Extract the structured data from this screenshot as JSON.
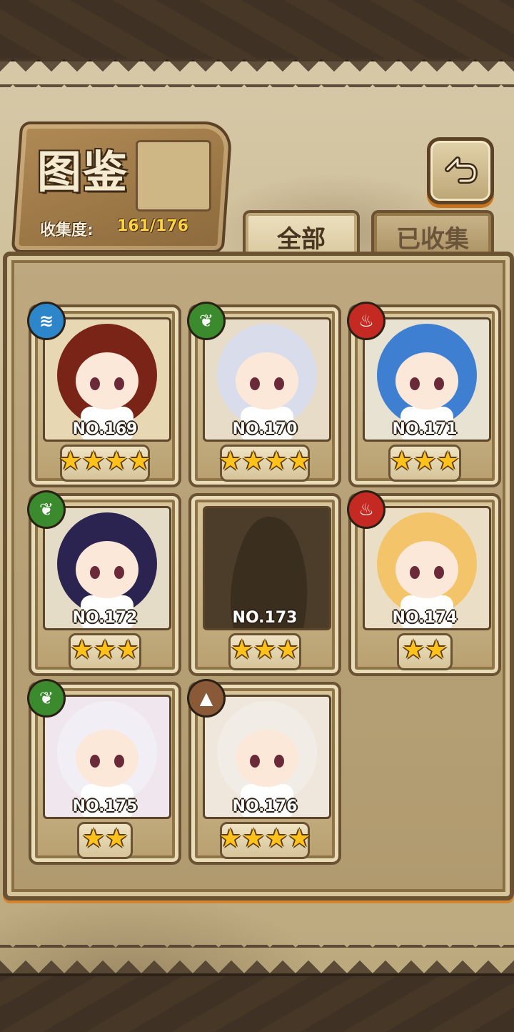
{
  "header": {
    "title": "图鉴",
    "collection_label": "收集度:",
    "collection_value": "161/176"
  },
  "tabs": [
    {
      "label": "全部",
      "active": true
    },
    {
      "label": "已收集",
      "active": false
    }
  ],
  "colors": {
    "accent_orange": "#d28530",
    "collection_value": "#ffd23e",
    "star": "#ffc21a",
    "water": "#2c86c9",
    "leaf": "#3b8a2e",
    "fire": "#c42a22",
    "earth": "#8a5a38"
  },
  "cards": [
    {
      "number": "NO.169",
      "stars": 4,
      "element": "water",
      "element_icon": "water-wave-icon",
      "collected": true,
      "art_bg": "#e7d7b3",
      "hair": "#7a2418"
    },
    {
      "number": "NO.170",
      "stars": 4,
      "element": "leaf",
      "element_icon": "leaf-icon",
      "collected": true,
      "art_bg": "#e6dcc7",
      "hair": "#d9dcea"
    },
    {
      "number": "NO.171",
      "stars": 3,
      "element": "fire",
      "element_icon": "flame-icon",
      "collected": true,
      "art_bg": "#e8e2d2",
      "hair": "#3f7fd1"
    },
    {
      "number": "NO.172",
      "stars": 3,
      "element": "leaf",
      "element_icon": "leaf-icon",
      "collected": true,
      "art_bg": "#e5dcc7",
      "hair": "#2c2450"
    },
    {
      "number": "NO.173",
      "stars": 3,
      "element": "",
      "element_icon": "",
      "collected": false,
      "art_bg": "#4c3d2a",
      "hair": ""
    },
    {
      "number": "NO.174",
      "stars": 2,
      "element": "fire",
      "element_icon": "flame-icon",
      "collected": true,
      "art_bg": "#eadfc6",
      "hair": "#f4c46a"
    },
    {
      "number": "NO.175",
      "stars": 2,
      "element": "leaf",
      "element_icon": "leaf-icon",
      "collected": true,
      "art_bg": "#f0e6ee",
      "hair": "#f2eef5"
    },
    {
      "number": "NO.176",
      "stars": 4,
      "element": "earth",
      "element_icon": "mountain-icon",
      "collected": true,
      "art_bg": "#efe6dc",
      "hair": "#f1ede6"
    }
  ]
}
